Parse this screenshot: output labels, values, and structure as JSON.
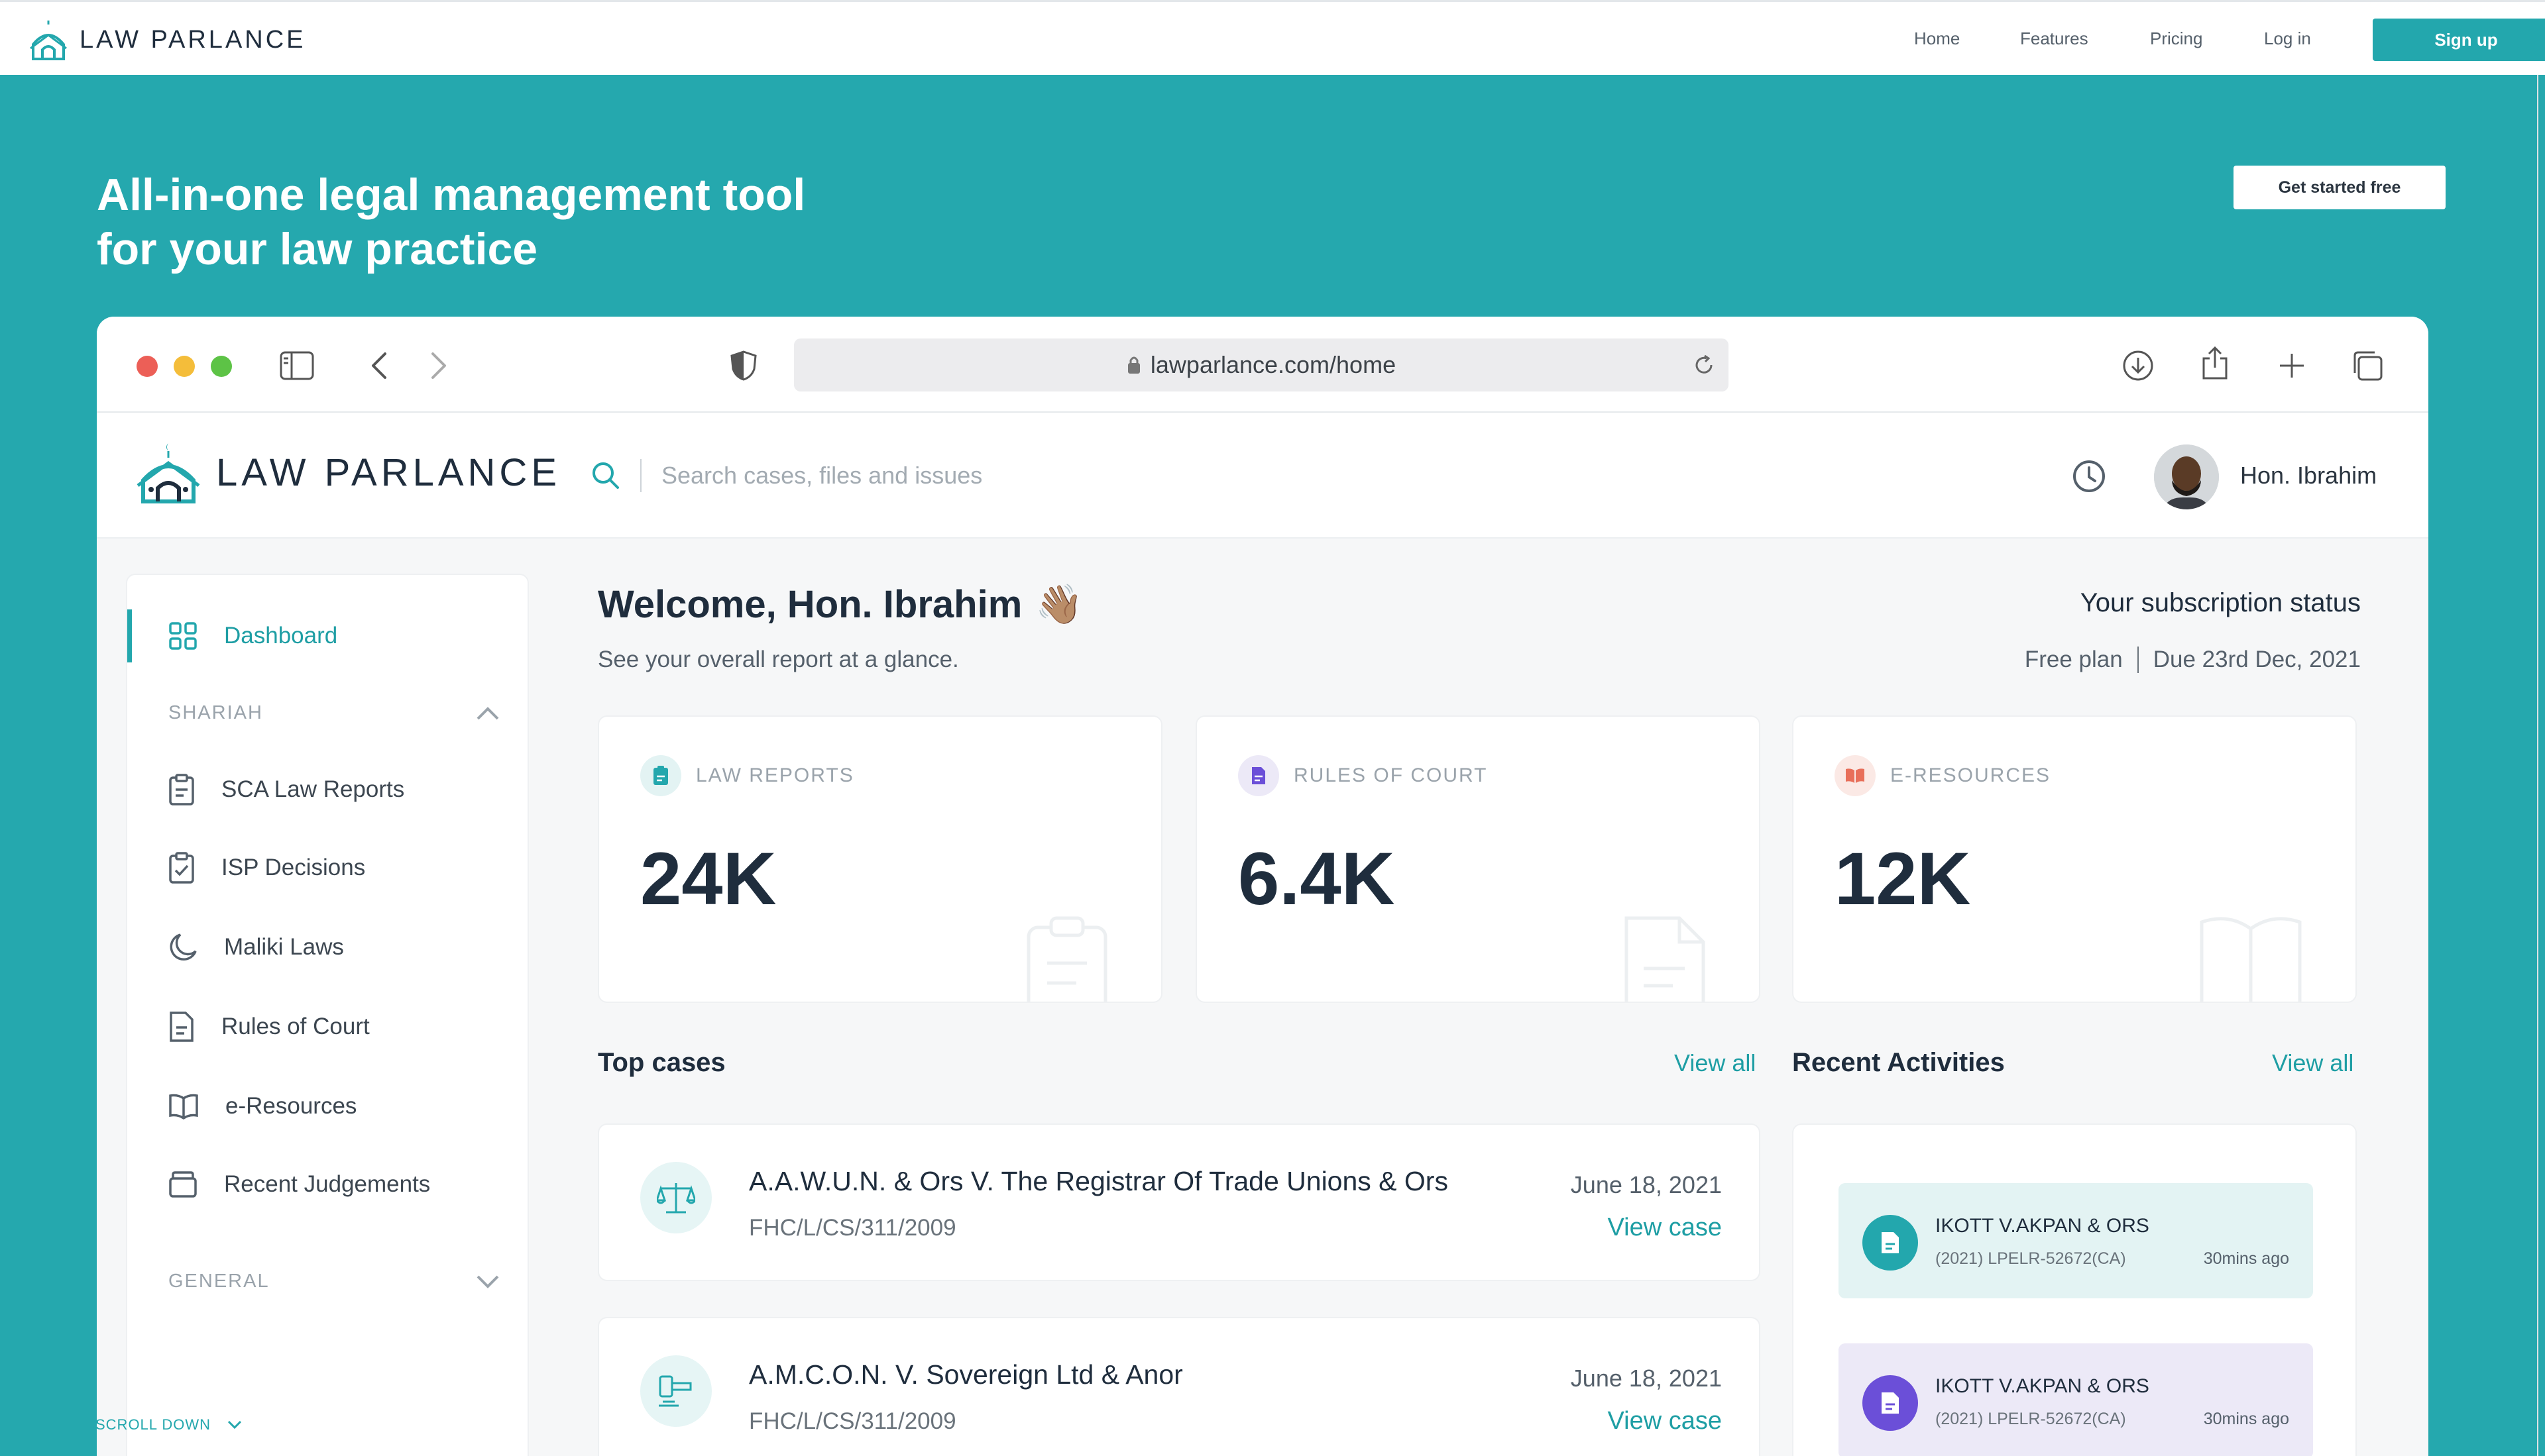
{
  "site": {
    "brand": "LAW PARLANCE",
    "nav": [
      "Home",
      "Features",
      "Pricing",
      "Log in"
    ],
    "signup": "Sign up",
    "get_started": "Get started free",
    "hero_line1": "All-in-one legal management tool",
    "hero_line2": "for your law practice",
    "scroll_hint": "SCROLL DOWN"
  },
  "browser": {
    "url": "lawparlance.com/home"
  },
  "app": {
    "brand": "LAW PARLANCE",
    "search_placeholder": "Search cases, files and issues",
    "user_name": "Hon. Ibrahim"
  },
  "sidebar": {
    "dashboard": "Dashboard",
    "section_shariah": "SHARIAH",
    "items": [
      "SCA Law Reports",
      "ISP Decisions",
      "Maliki Laws",
      "Rules of Court",
      "e-Resources",
      "Recent Judgements"
    ],
    "section_general": "GENERAL"
  },
  "main": {
    "welcome": "Welcome, Hon. Ibrahim",
    "welcome_emoji": "👋🏽",
    "welcome_sub": "See your overall report at a glance.",
    "subs_title": "Your subscription status",
    "subs_plan": "Free plan",
    "subs_due": "Due 23rd Dec, 2021"
  },
  "stats": [
    {
      "label": "LAW REPORTS",
      "value": "24K",
      "color": "#23a7ad"
    },
    {
      "label": "RULES OF COURT",
      "value": "6.4K",
      "color": "#6b4fd8"
    },
    {
      "label": "E-RESOURCES",
      "value": "12K",
      "color": "#e86f5a"
    }
  ],
  "top_cases": {
    "title": "Top cases",
    "view_all": "View all",
    "cases": [
      {
        "title": "A.A.W.U.N. & Ors V. The Registrar Of Trade Unions & Ors",
        "code": "FHC/L/CS/311/2009",
        "date": "June 18, 2021",
        "link": "View case"
      },
      {
        "title": "A.M.C.O.N. V. Sovereign Ltd & Anor",
        "code": "FHC/L/CS/311/2009",
        "date": "June 18, 2021",
        "link": "View case"
      }
    ]
  },
  "activities": {
    "title": "Recent Activities",
    "view_all": "View all",
    "items": [
      {
        "title": "IKOTT V.AKPAN & ORS",
        "code": "(2021) LPELR-52672(CA)",
        "time": "30mins ago",
        "color": "#23a7ad",
        "bg": "#e3f3f3"
      },
      {
        "title": "IKOTT V.AKPAN & ORS",
        "code": "(2021) LPELR-52672(CA)",
        "time": "30mins ago",
        "color": "#6b4fd8",
        "bg": "#ece9f7"
      }
    ]
  }
}
